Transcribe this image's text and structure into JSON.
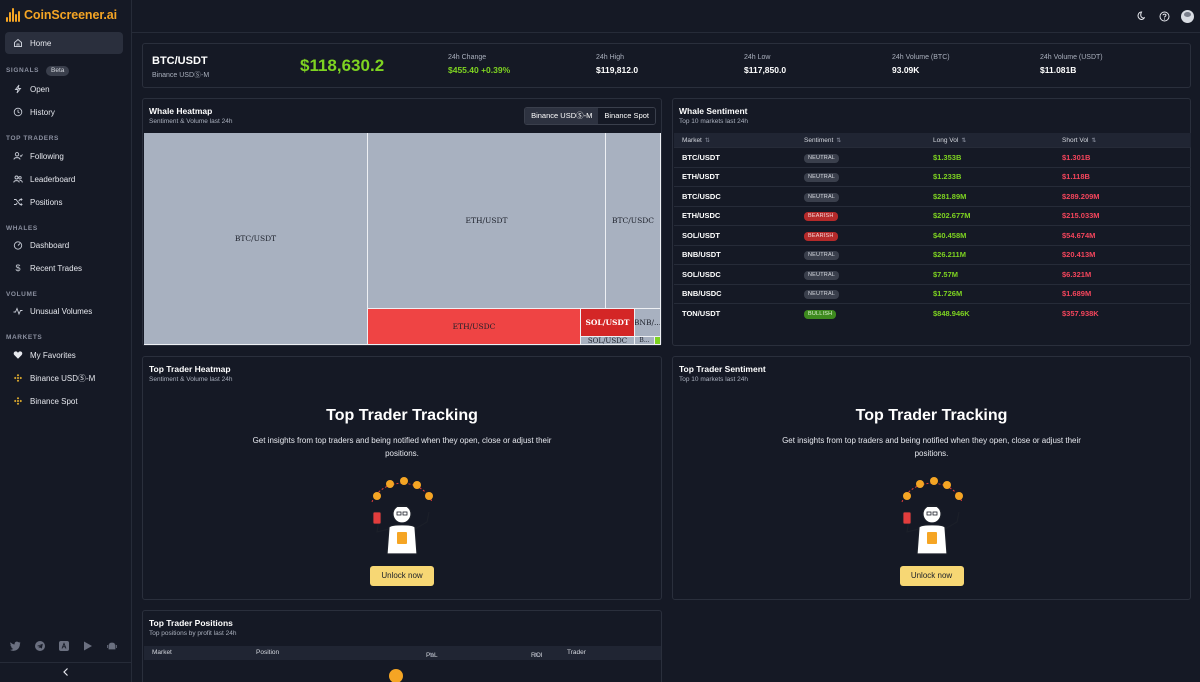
{
  "brand": {
    "name": "CoinScreener.ai",
    "color": "#f5a524"
  },
  "nav": {
    "home": "Home",
    "signals_label": "SIGNALS",
    "beta": "Beta",
    "open": "Open",
    "history": "History",
    "top_traders_label": "TOP TRADERS",
    "following": "Following",
    "leaderboard": "Leaderboard",
    "positions": "Positions",
    "whales_label": "WHALES",
    "dashboard": "Dashboard",
    "recent_trades": "Recent Trades",
    "volume_label": "VOLUME",
    "unusual_volumes": "Unusual Volumes",
    "markets_label": "MARKETS",
    "my_favorites": "My Favorites",
    "binance_usdm": "Binance USDⓈ-M",
    "binance_spot": "Binance Spot"
  },
  "ticker": {
    "pair": "BTC/USDT",
    "exchange": "Binance USDⓈ-M",
    "price": "$118,630.2",
    "stats": [
      {
        "label": "24h Change",
        "value": "$455.40 +0.39%"
      },
      {
        "label": "24h High",
        "value": "$119,812.0"
      },
      {
        "label": "24h Low",
        "value": "$117,850.0"
      },
      {
        "label": "24h Volume (BTC)",
        "value": "93.09K"
      },
      {
        "label": "24h Volume (USDT)",
        "value": "$11.081B"
      }
    ]
  },
  "whale_heatmap": {
    "title": "Whale Heatmap",
    "subtitle": "Sentiment & Volume last 24h",
    "tabs": [
      "Binance USDⓈ-M",
      "Binance Spot"
    ],
    "cells": [
      "BTC/USDT",
      "ETH/USDT",
      "BTC/USDC",
      "ETH/USDC",
      "SOL/USDT",
      "BNB/...",
      "SOL/USDC",
      "B..."
    ]
  },
  "whale_sentiment": {
    "title": "Whale Sentiment",
    "subtitle": "Top 10 markets last 24h",
    "headers": [
      "Market",
      "Sentiment",
      "Long Vol",
      "Short Vol"
    ],
    "rows": [
      {
        "market": "BTC/USDT",
        "sentiment": "NEUTRAL",
        "long": "$1.353B",
        "short": "$1.301B"
      },
      {
        "market": "ETH/USDT",
        "sentiment": "NEUTRAL",
        "long": "$1.233B",
        "short": "$1.118B"
      },
      {
        "market": "BTC/USDC",
        "sentiment": "NEUTRAL",
        "long": "$281.89M",
        "short": "$289.209M"
      },
      {
        "market": "ETH/USDC",
        "sentiment": "BEARISH",
        "long": "$202.677M",
        "short": "$215.033M"
      },
      {
        "market": "SOL/USDT",
        "sentiment": "BEARISH",
        "long": "$40.458M",
        "short": "$54.674M"
      },
      {
        "market": "BNB/USDT",
        "sentiment": "NEUTRAL",
        "long": "$26.211M",
        "short": "$20.413M"
      },
      {
        "market": "SOL/USDC",
        "sentiment": "NEUTRAL",
        "long": "$7.57M",
        "short": "$6.321M"
      },
      {
        "market": "BNB/USDC",
        "sentiment": "NEUTRAL",
        "long": "$1.726M",
        "short": "$1.689M"
      },
      {
        "market": "TON/USDT",
        "sentiment": "BULLISH",
        "long": "$848.946K",
        "short": "$357.938K"
      }
    ]
  },
  "top_trader_heatmap": {
    "title": "Top Trader Heatmap",
    "subtitle": "Sentiment & Volume last 24h"
  },
  "top_trader_sentiment": {
    "title": "Top Trader Sentiment",
    "subtitle": "Top 10 markets last 24h"
  },
  "promo": {
    "title": "Top Trader Tracking",
    "text": "Get insights from top traders and being notified when they open, close or adjust their positions.",
    "button": "Unlock now"
  },
  "top_trader_positions": {
    "title": "Top Trader Positions",
    "subtitle": "Top positions by profit last 24h",
    "headers": [
      "Market",
      "Position",
      "PnL",
      "ROI",
      "Trader"
    ]
  },
  "colors": {
    "green": "#7ed321",
    "red": "#f5455c",
    "heat_neutral": "#a8b1c0",
    "heat_red": "#ef4444",
    "heat_dark_red": "#d42626",
    "button": "#f7d774"
  }
}
